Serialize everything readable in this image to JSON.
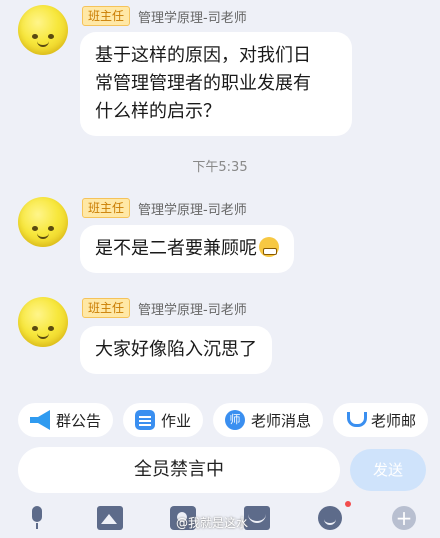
{
  "messages": [
    {
      "badge": "班主任",
      "sender": "管理学原理-司老师",
      "lines": [
        "基于这样的原因，对我们日",
        "常管理管理者的职业发展有",
        "什么样的启示？"
      ]
    },
    {
      "badge": "班主任",
      "sender": "管理学原理-司老师",
      "text": "是不是二者要兼顾呢"
    },
    {
      "badge": "班主任",
      "sender": "管理学原理-司老师",
      "text": "大家好像陷入沉思了"
    }
  ],
  "timestamp": "下午5:35",
  "quickbar": [
    {
      "label": "群公告",
      "icon": "megaphone-icon"
    },
    {
      "label": "作业",
      "icon": "document-icon"
    },
    {
      "label": "老师消息",
      "icon": "teacher-icon"
    },
    {
      "label": "老师邮",
      "icon": "u-icon"
    }
  ],
  "input": {
    "mute_text": "全员禁言中",
    "send_label": "发送"
  },
  "toolbar": {
    "plus": "+"
  },
  "watermark": "@我就是这水"
}
